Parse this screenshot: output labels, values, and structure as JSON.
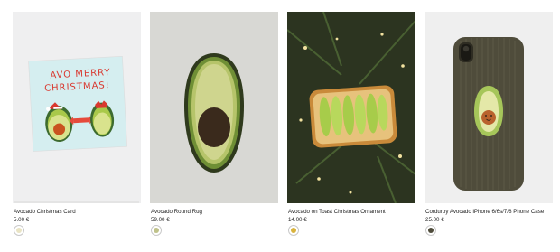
{
  "products": [
    {
      "name": "Avocado Christmas Card",
      "price": "5.00 €",
      "card_text": "AVO MERRY CHRISTMAS!",
      "swatch_color": "#e9e4c4",
      "image": "avocado-christmas-card-image"
    },
    {
      "name": "Avocado Round Rug",
      "price": "59.00 €",
      "swatch_color": "#bfc28a",
      "image": "avocado-rug-image"
    },
    {
      "name": "Avocado on Toast Christmas Ornament",
      "price": "14.00 €",
      "swatch_color": "#d9b33d",
      "image": "avocado-toast-ornament-image"
    },
    {
      "name": "Corduroy Avocado iPhone 6/6s/7/8 Phone Case",
      "price": "25.00 €",
      "swatch_color": "#4f4c3b",
      "image": "corduroy-phone-case-image"
    }
  ]
}
